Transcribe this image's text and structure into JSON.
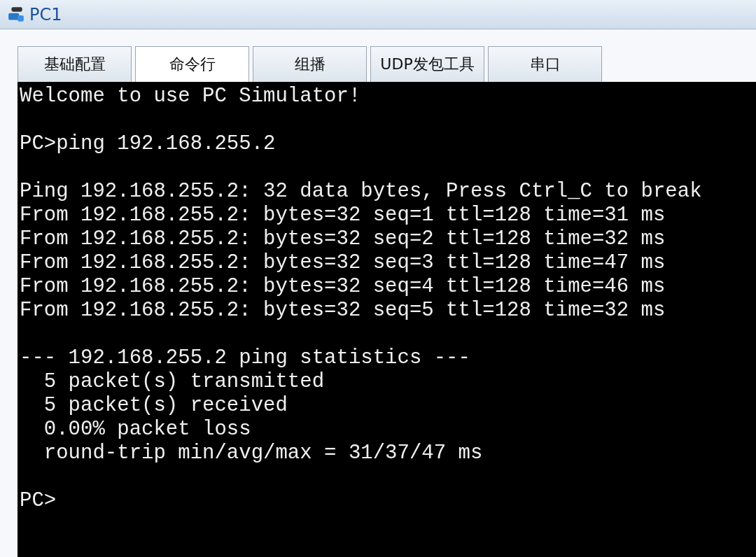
{
  "window": {
    "title": "PC1"
  },
  "tabs": [
    {
      "label": "基础配置",
      "selected": false
    },
    {
      "label": "命令行",
      "selected": true
    },
    {
      "label": "组播",
      "selected": false
    },
    {
      "label": "UDP发包工具",
      "selected": false
    },
    {
      "label": "串口",
      "selected": false
    }
  ],
  "console": {
    "blocks": [
      [
        "Welcome to use PC Simulator!"
      ],
      [
        "PC>ping 192.168.255.2"
      ],
      [
        "Ping 192.168.255.2: 32 data bytes, Press Ctrl_C to break",
        "From 192.168.255.2: bytes=32 seq=1 ttl=128 time=31 ms",
        "From 192.168.255.2: bytes=32 seq=2 ttl=128 time=32 ms",
        "From 192.168.255.2: bytes=32 seq=3 ttl=128 time=47 ms",
        "From 192.168.255.2: bytes=32 seq=4 ttl=128 time=46 ms",
        "From 192.168.255.2: bytes=32 seq=5 ttl=128 time=32 ms"
      ],
      [
        "--- 192.168.255.2 ping statistics ---",
        "  5 packet(s) transmitted",
        "  5 packet(s) received",
        "  0.00% packet loss",
        "  round-trip min/avg/max = 31/37/47 ms"
      ],
      [
        "PC>"
      ]
    ]
  }
}
